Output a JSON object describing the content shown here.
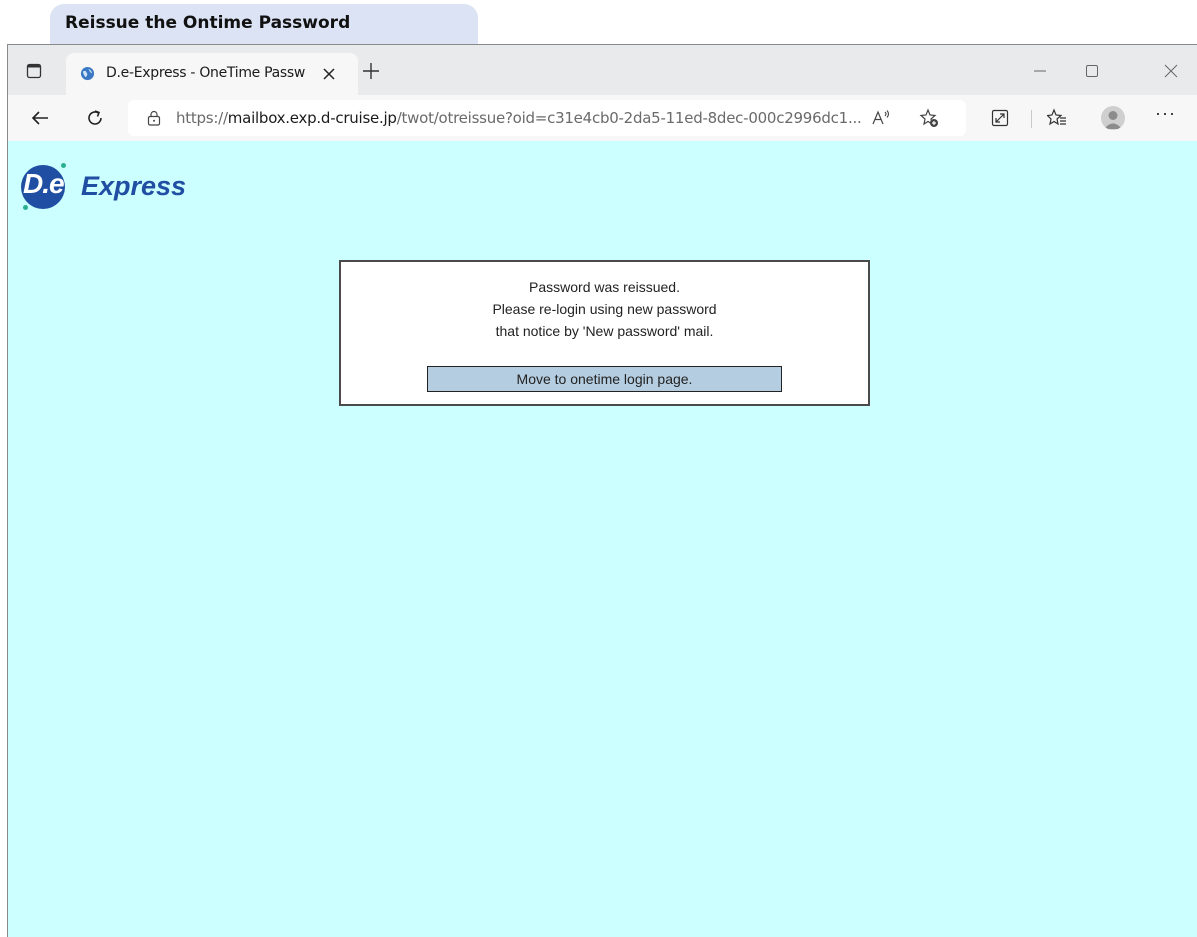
{
  "caption": {
    "text": "Reissue the Ontime Password"
  },
  "browser": {
    "tab": {
      "title": "D.e-Express - OneTime Password"
    },
    "address": {
      "url_prefix": "https://",
      "url_host": "mailbox.exp.d-cruise.jp",
      "url_path": "/twot/otreissue?oid=c31e4cb0-2da5-11ed-8dec-000c2996dc1..."
    },
    "more_label": "···"
  },
  "page": {
    "logo": {
      "mark": "D.e",
      "word": "Express"
    },
    "message": {
      "lines": [
        "Password was reissued.",
        "Please re-login using new password",
        "that notice by 'New password' mail."
      ]
    },
    "button_label": "Move to onetime login page."
  },
  "colors": {
    "page_background": "#ccffff",
    "button_background": "#b5cde0",
    "brand_blue": "#1f4ea2"
  }
}
